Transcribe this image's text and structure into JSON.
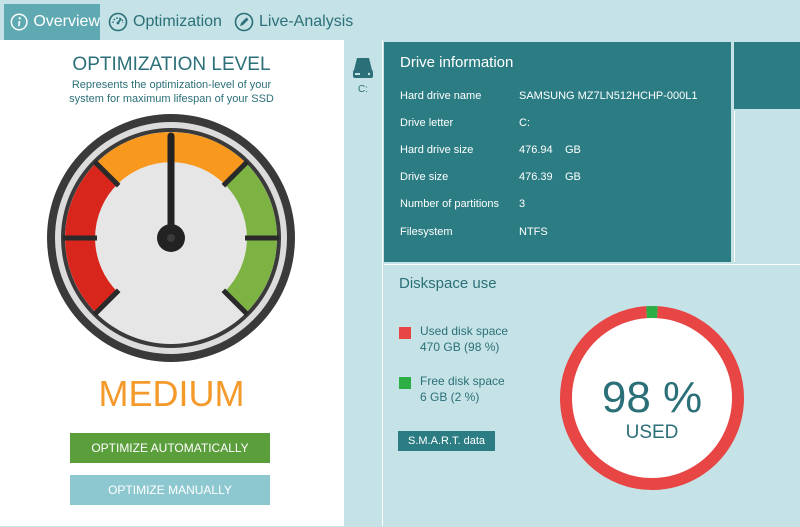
{
  "tabs": [
    {
      "label": "Overview",
      "icon": "info-icon",
      "active": true
    },
    {
      "label": "Optimization",
      "icon": "speedometer-icon",
      "active": false
    },
    {
      "label": "Live-Analysis",
      "icon": "pencil-icon",
      "active": false
    }
  ],
  "optimization": {
    "title": "OPTIMIZATION LEVEL",
    "subtitle_line1": "Represents the optimization-level of your",
    "subtitle_line2": "system for maximum lifespan of your SSD",
    "level": "MEDIUM",
    "level_value": 0.5,
    "auto_button": "OPTIMIZE AUTOMATICALLY",
    "manual_button": "OPTIMIZE MANUALLY"
  },
  "drive_selector": {
    "letter": "C:",
    "icon": "drive-icon"
  },
  "drive_info": {
    "title": "Drive information",
    "rows": [
      {
        "label": "Hard drive name",
        "value": "SAMSUNG MZ7LN512HCHP-000L1",
        "unit": ""
      },
      {
        "label": "Drive letter",
        "value": "C:",
        "unit": ""
      },
      {
        "label": "Hard drive size",
        "value": "476.94",
        "unit": "GB"
      },
      {
        "label": "Drive size",
        "value": "476.39",
        "unit": "GB"
      },
      {
        "label": "Number of partitions",
        "value": "3",
        "unit": ""
      },
      {
        "label": "Filesystem",
        "value": "NTFS",
        "unit": ""
      }
    ]
  },
  "diskspace": {
    "title": "Diskspace use",
    "used_label": "Used disk space",
    "used_value": "470 GB (98 %)",
    "free_label": "Free disk space",
    "free_value": "6 GB (2 %)",
    "smart_button": "S.M.A.R.T. data",
    "percent_text": "98 %",
    "used_caption": "USED",
    "used_fraction": 0.98,
    "used_color": "#e84545",
    "free_color": "#2dae45"
  },
  "colors": {
    "accent": "#2c7d83",
    "level_text": "#f39a2a",
    "gauge_red": "#d9261c",
    "gauge_orange": "#f8981d",
    "gauge_green": "#7cb342"
  }
}
